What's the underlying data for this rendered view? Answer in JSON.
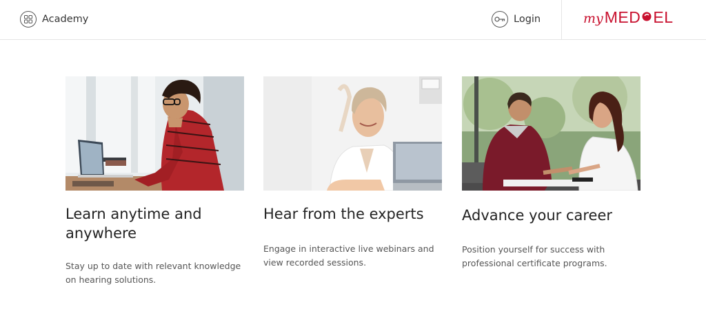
{
  "header": {
    "academy_label": "Academy",
    "academy_icon": "grid-circle-icon",
    "login_label": "Login",
    "login_icon": "key-circle-icon",
    "logo": {
      "my": "my",
      "brand": "MED",
      "brand_suffix": "EL",
      "color": "#c8102e"
    }
  },
  "cards": [
    {
      "image": "woman-studying-laptop-photo",
      "title": "Learn anytime and anywhere",
      "text": "Stay up to date with relevant knowledge on hearing solutions."
    },
    {
      "image": "smiling-expert-doctor-photo",
      "title": "Hear from the experts",
      "text": "Engage in interactive live webinars and view recorded sessions."
    },
    {
      "image": "doctor-consulting-patient-photo",
      "title": "Advance your career",
      "text": "Position yourself for success with professional certificate programs."
    }
  ]
}
